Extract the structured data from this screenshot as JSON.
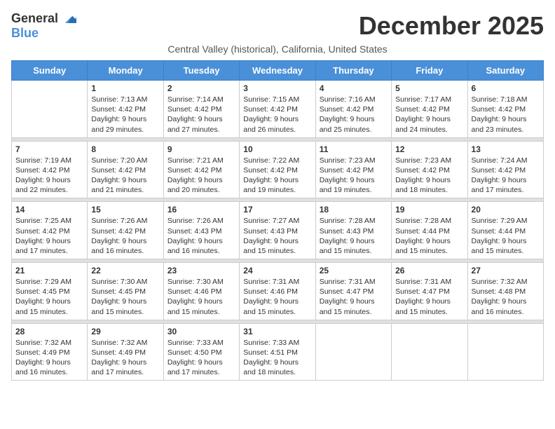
{
  "header": {
    "logo_general": "General",
    "logo_blue": "Blue",
    "month_title": "December 2025",
    "subtitle": "Central Valley (historical), California, United States"
  },
  "days_of_week": [
    "Sunday",
    "Monday",
    "Tuesday",
    "Wednesday",
    "Thursday",
    "Friday",
    "Saturday"
  ],
  "weeks": [
    [
      {
        "day": "",
        "sunrise": "",
        "sunset": "",
        "daylight": ""
      },
      {
        "day": "1",
        "sunrise": "Sunrise: 7:13 AM",
        "sunset": "Sunset: 4:42 PM",
        "daylight": "Daylight: 9 hours and 29 minutes."
      },
      {
        "day": "2",
        "sunrise": "Sunrise: 7:14 AM",
        "sunset": "Sunset: 4:42 PM",
        "daylight": "Daylight: 9 hours and 27 minutes."
      },
      {
        "day": "3",
        "sunrise": "Sunrise: 7:15 AM",
        "sunset": "Sunset: 4:42 PM",
        "daylight": "Daylight: 9 hours and 26 minutes."
      },
      {
        "day": "4",
        "sunrise": "Sunrise: 7:16 AM",
        "sunset": "Sunset: 4:42 PM",
        "daylight": "Daylight: 9 hours and 25 minutes."
      },
      {
        "day": "5",
        "sunrise": "Sunrise: 7:17 AM",
        "sunset": "Sunset: 4:42 PM",
        "daylight": "Daylight: 9 hours and 24 minutes."
      },
      {
        "day": "6",
        "sunrise": "Sunrise: 7:18 AM",
        "sunset": "Sunset: 4:42 PM",
        "daylight": "Daylight: 9 hours and 23 minutes."
      }
    ],
    [
      {
        "day": "7",
        "sunrise": "Sunrise: 7:19 AM",
        "sunset": "Sunset: 4:42 PM",
        "daylight": "Daylight: 9 hours and 22 minutes."
      },
      {
        "day": "8",
        "sunrise": "Sunrise: 7:20 AM",
        "sunset": "Sunset: 4:42 PM",
        "daylight": "Daylight: 9 hours and 21 minutes."
      },
      {
        "day": "9",
        "sunrise": "Sunrise: 7:21 AM",
        "sunset": "Sunset: 4:42 PM",
        "daylight": "Daylight: 9 hours and 20 minutes."
      },
      {
        "day": "10",
        "sunrise": "Sunrise: 7:22 AM",
        "sunset": "Sunset: 4:42 PM",
        "daylight": "Daylight: 9 hours and 19 minutes."
      },
      {
        "day": "11",
        "sunrise": "Sunrise: 7:23 AM",
        "sunset": "Sunset: 4:42 PM",
        "daylight": "Daylight: 9 hours and 19 minutes."
      },
      {
        "day": "12",
        "sunrise": "Sunrise: 7:23 AM",
        "sunset": "Sunset: 4:42 PM",
        "daylight": "Daylight: 9 hours and 18 minutes."
      },
      {
        "day": "13",
        "sunrise": "Sunrise: 7:24 AM",
        "sunset": "Sunset: 4:42 PM",
        "daylight": "Daylight: 9 hours and 17 minutes."
      }
    ],
    [
      {
        "day": "14",
        "sunrise": "Sunrise: 7:25 AM",
        "sunset": "Sunset: 4:42 PM",
        "daylight": "Daylight: 9 hours and 17 minutes."
      },
      {
        "day": "15",
        "sunrise": "Sunrise: 7:26 AM",
        "sunset": "Sunset: 4:42 PM",
        "daylight": "Daylight: 9 hours and 16 minutes."
      },
      {
        "day": "16",
        "sunrise": "Sunrise: 7:26 AM",
        "sunset": "Sunset: 4:43 PM",
        "daylight": "Daylight: 9 hours and 16 minutes."
      },
      {
        "day": "17",
        "sunrise": "Sunrise: 7:27 AM",
        "sunset": "Sunset: 4:43 PM",
        "daylight": "Daylight: 9 hours and 15 minutes."
      },
      {
        "day": "18",
        "sunrise": "Sunrise: 7:28 AM",
        "sunset": "Sunset: 4:43 PM",
        "daylight": "Daylight: 9 hours and 15 minutes."
      },
      {
        "day": "19",
        "sunrise": "Sunrise: 7:28 AM",
        "sunset": "Sunset: 4:44 PM",
        "daylight": "Daylight: 9 hours and 15 minutes."
      },
      {
        "day": "20",
        "sunrise": "Sunrise: 7:29 AM",
        "sunset": "Sunset: 4:44 PM",
        "daylight": "Daylight: 9 hours and 15 minutes."
      }
    ],
    [
      {
        "day": "21",
        "sunrise": "Sunrise: 7:29 AM",
        "sunset": "Sunset: 4:45 PM",
        "daylight": "Daylight: 9 hours and 15 minutes."
      },
      {
        "day": "22",
        "sunrise": "Sunrise: 7:30 AM",
        "sunset": "Sunset: 4:45 PM",
        "daylight": "Daylight: 9 hours and 15 minutes."
      },
      {
        "day": "23",
        "sunrise": "Sunrise: 7:30 AM",
        "sunset": "Sunset: 4:46 PM",
        "daylight": "Daylight: 9 hours and 15 minutes."
      },
      {
        "day": "24",
        "sunrise": "Sunrise: 7:31 AM",
        "sunset": "Sunset: 4:46 PM",
        "daylight": "Daylight: 9 hours and 15 minutes."
      },
      {
        "day": "25",
        "sunrise": "Sunrise: 7:31 AM",
        "sunset": "Sunset: 4:47 PM",
        "daylight": "Daylight: 9 hours and 15 minutes."
      },
      {
        "day": "26",
        "sunrise": "Sunrise: 7:31 AM",
        "sunset": "Sunset: 4:47 PM",
        "daylight": "Daylight: 9 hours and 15 minutes."
      },
      {
        "day": "27",
        "sunrise": "Sunrise: 7:32 AM",
        "sunset": "Sunset: 4:48 PM",
        "daylight": "Daylight: 9 hours and 16 minutes."
      }
    ],
    [
      {
        "day": "28",
        "sunrise": "Sunrise: 7:32 AM",
        "sunset": "Sunset: 4:49 PM",
        "daylight": "Daylight: 9 hours and 16 minutes."
      },
      {
        "day": "29",
        "sunrise": "Sunrise: 7:32 AM",
        "sunset": "Sunset: 4:49 PM",
        "daylight": "Daylight: 9 hours and 17 minutes."
      },
      {
        "day": "30",
        "sunrise": "Sunrise: 7:33 AM",
        "sunset": "Sunset: 4:50 PM",
        "daylight": "Daylight: 9 hours and 17 minutes."
      },
      {
        "day": "31",
        "sunrise": "Sunrise: 7:33 AM",
        "sunset": "Sunset: 4:51 PM",
        "daylight": "Daylight: 9 hours and 18 minutes."
      },
      {
        "day": "",
        "sunrise": "",
        "sunset": "",
        "daylight": ""
      },
      {
        "day": "",
        "sunrise": "",
        "sunset": "",
        "daylight": ""
      },
      {
        "day": "",
        "sunrise": "",
        "sunset": "",
        "daylight": ""
      }
    ]
  ]
}
